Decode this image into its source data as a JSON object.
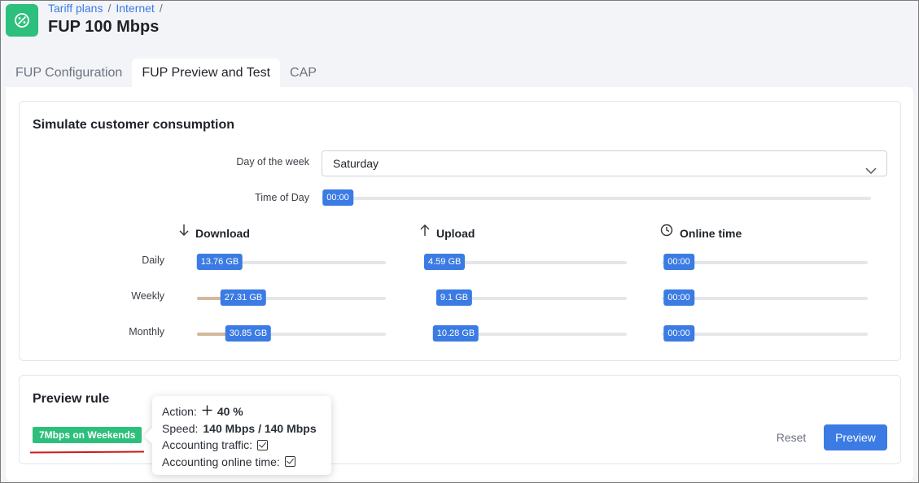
{
  "breadcrumb": [
    "Tariff plans",
    "Internet"
  ],
  "page_title": "FUP 100 Mbps",
  "tabs": [
    {
      "label": "FUP Configuration",
      "active": false
    },
    {
      "label": "FUP Preview and Test",
      "active": true
    },
    {
      "label": "CAP",
      "active": false
    }
  ],
  "simulate": {
    "title": "Simulate customer consumption",
    "day_label": "Day of the week",
    "day_value": "Saturday",
    "time_label": "Time of Day",
    "time_value": "00:00",
    "columns": {
      "download": {
        "label": "Download",
        "icon": "arrow-down-icon"
      },
      "upload": {
        "label": "Upload",
        "icon": "arrow-up-icon"
      },
      "online": {
        "label": "Online time",
        "icon": "clock-icon"
      }
    },
    "rows": {
      "daily": {
        "label": "Daily",
        "download": "13.76 GB",
        "upload": "4.59 GB",
        "online": "00:00"
      },
      "weekly": {
        "label": "Weekly",
        "download": "27.31 GB",
        "upload": "9.1 GB",
        "online": "00:00"
      },
      "monthly": {
        "label": "Monthly",
        "download": "30.85 GB",
        "upload": "10.28 GB",
        "online": "00:00"
      }
    }
  },
  "preview": {
    "title": "Preview rule",
    "rule_badge": "7Mbps on Weekends",
    "tooltip": {
      "action_label": "Action:",
      "action_value": "40 %",
      "speed_label": "Speed:",
      "speed_value": "140 Mbps / 140 Mbps",
      "accounting_traffic_label": "Accounting traffic:",
      "accounting_online_label": "Accounting online time:"
    },
    "reset_label": "Reset",
    "preview_label": "Preview"
  },
  "colors": {
    "accent": "#3b7be3",
    "success": "#2dbf7c",
    "slider_fill": "#d4b89c",
    "annotation": "#cc1a1a"
  }
}
